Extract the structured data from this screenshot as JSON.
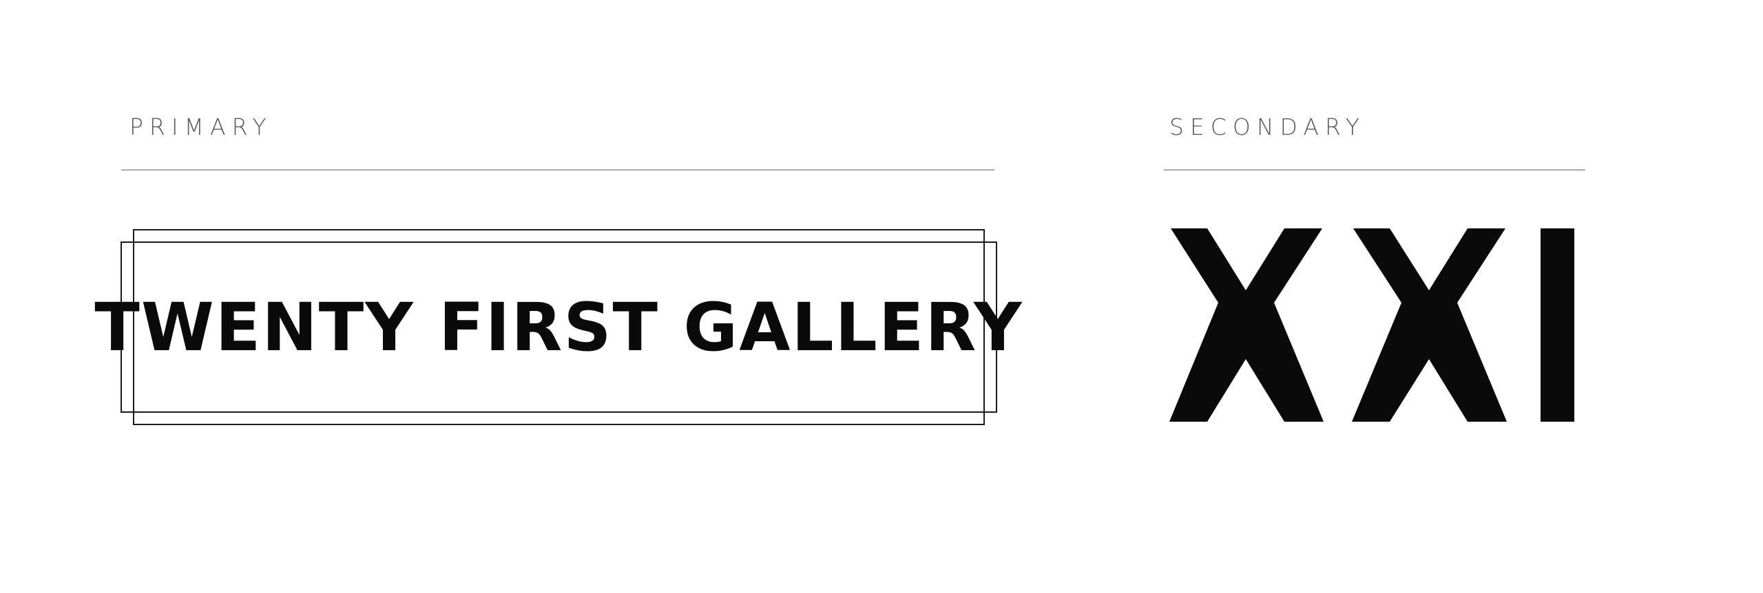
{
  "primary": {
    "label": "PRIMARY",
    "wordmark": "TWENTY FIRST GALLERY"
  },
  "secondary": {
    "label": "SECONDARY",
    "monogram": "XXI"
  },
  "colors": {
    "label_text": "#58595b",
    "rule": "#a7a9ac",
    "ink": "#0a0a0a"
  }
}
